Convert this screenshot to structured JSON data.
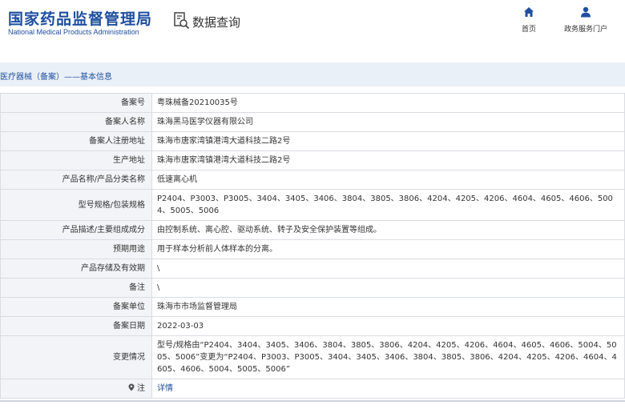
{
  "header": {
    "logo_cn": "国家药品监督管理局",
    "logo_en": "National Medical Products Administration",
    "search_title": "数据查询",
    "nav": {
      "home_label": "首页",
      "gov_label": "政务服务门户"
    }
  },
  "breadcrumb": "医疗器械（备案）——基本信息",
  "rows": [
    {
      "label": "备案号",
      "value": "粤珠械备20210035号"
    },
    {
      "label": "备案人名称",
      "value": "珠海黑马医学仪器有限公司"
    },
    {
      "label": "备案人注册地址",
      "value": "珠海市唐家湾镇港湾大道科技二路2号"
    },
    {
      "label": "生产地址",
      "value": "珠海市唐家湾镇港湾大道科技二路2号"
    },
    {
      "label": "产品名称/产品分类名称",
      "value": "低速离心机"
    },
    {
      "label": "型号规格/包装规格",
      "value": "P2404、P3003、P3005、3404、3405、3406、3804、3805、3806、4204、4205、4206、4604、4605、4606、5004、5005、5006"
    },
    {
      "label": "产品描述/主要组成成分",
      "value": "由控制系统、离心腔、驱动系统、转子及安全保护装置等组成。"
    },
    {
      "label": "预期用途",
      "value": "用于样本分析前人体样本的分离。"
    },
    {
      "label": "产品存储及有效期",
      "value": "\\"
    },
    {
      "label": "备注",
      "value": "\\"
    },
    {
      "label": "备案单位",
      "value": "珠海市市场监督管理局"
    },
    {
      "label": "备案日期",
      "value": "2022-03-03"
    },
    {
      "label": "变更情况",
      "value": "型号/规格由“P2404、3404、3405、3406、3804、3805、3806、4204、4205、4206、4604、4605、4606、5004、5005、5006”变更为“P2404、P3003、P3005、3404、3405、3406、3804、3805、3806、4204、4205、4206、4604、4605、4606、5004、5005、5006”"
    }
  ],
  "note_row": {
    "label": "注",
    "link": "详情"
  },
  "colors": {
    "brand": "#1f4fa0",
    "label_bg": "#f2f4f7",
    "bar_bg": "#eaf0f7"
  },
  "icons": [
    "search-document-icon",
    "home-icon",
    "user-icon",
    "location-pin-icon"
  ]
}
